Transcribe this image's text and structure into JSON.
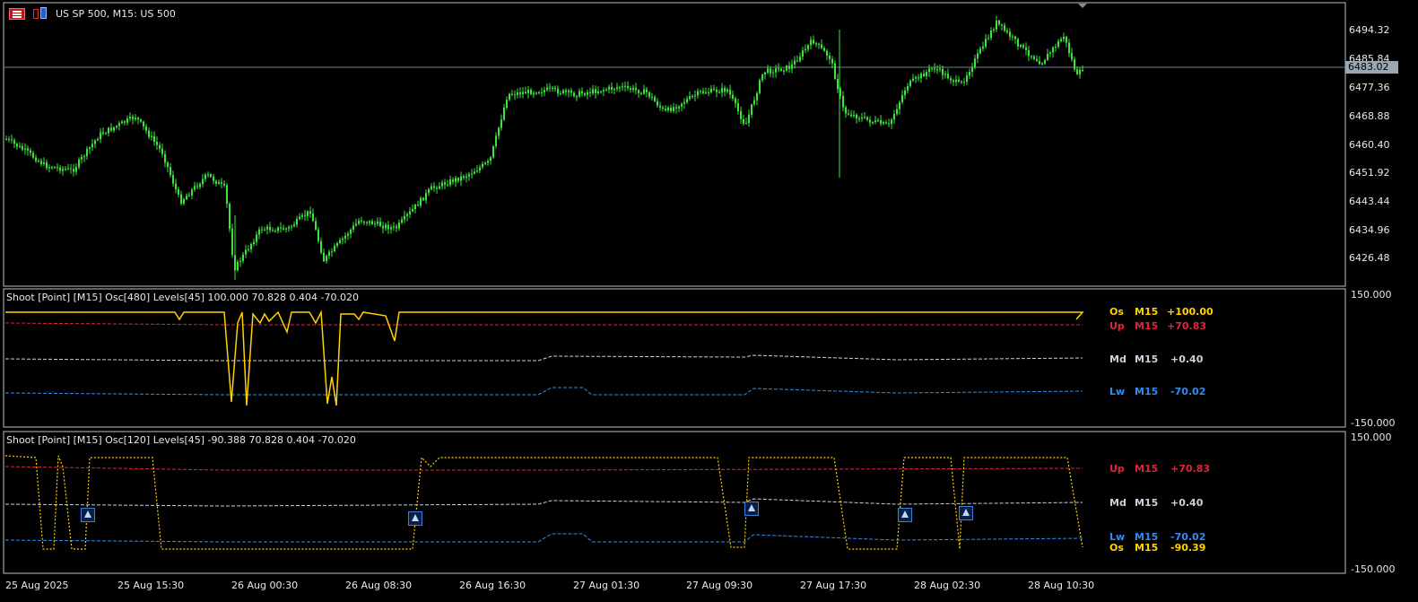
{
  "main_chart": {
    "title": "US SP 500, M15:  US 500",
    "price_labels": [
      "6494.32",
      "6485.84",
      "6477.36",
      "6468.88",
      "6460.40",
      "6451.92",
      "6443.44",
      "6434.96",
      "6426.48"
    ],
    "current_price": "6483.02",
    "icons": [
      "bars-icon",
      "chart-icon"
    ]
  },
  "osc1": {
    "header": "Shoot [Point] [M15]  Osc[480]  Levels[45] 100.000 70.828 0.404 -70.020",
    "axis_top": "150.000",
    "axis_bottom": "-150.000",
    "labels": [
      {
        "tag": "Os",
        "tf": "M15",
        "val": "+100.00",
        "color": "#ffd200"
      },
      {
        "tag": "Up",
        "tf": "M15",
        "val": "+70.83",
        "color": "#e0243a"
      },
      {
        "tag": "Md",
        "tf": "M15",
        "val": "+0.40",
        "color": "#c8d2e0"
      },
      {
        "tag": "Lw",
        "tf": "M15",
        "val": "-70.02",
        "color": "#2e8ef0"
      }
    ]
  },
  "osc2": {
    "header": "Shoot [Point] [M15]  Osc[120]  Levels[45] -90.388 70.828 0.404 -70.020",
    "axis_top": "150.000",
    "axis_bottom": "-150.000",
    "labels": [
      {
        "tag": "Up",
        "tf": "M15",
        "val": "+70.83",
        "color": "#e0243a"
      },
      {
        "tag": "Md",
        "tf": "M15",
        "val": "+0.40",
        "color": "#c8d2e0"
      },
      {
        "tag": "Lw",
        "tf": "M15",
        "val": "-70.02",
        "color": "#2e8ef0"
      },
      {
        "tag": "Os",
        "tf": "M15",
        "val": "-90.39",
        "color": "#ffd200"
      }
    ]
  },
  "time_labels": [
    "25 Aug 2025",
    "25 Aug 15:30",
    "26 Aug 00:30",
    "26 Aug 08:30",
    "26 Aug 16:30",
    "27 Aug 01:30",
    "27 Aug 09:30",
    "27 Aug 17:30",
    "28 Aug 02:30",
    "28 Aug 10:30"
  ]
}
